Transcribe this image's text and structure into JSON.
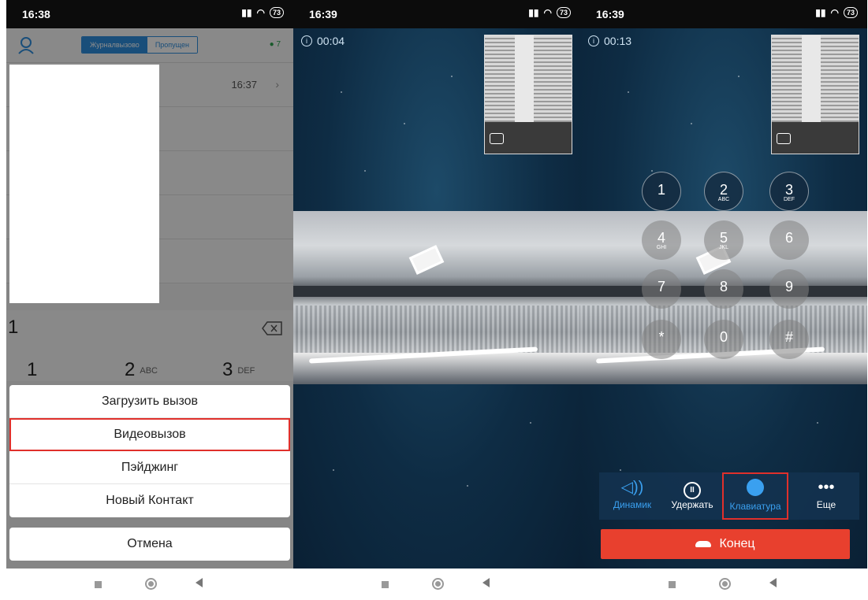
{
  "panel1": {
    "status": {
      "time": "16:38",
      "battery": "73"
    },
    "tabs": [
      {
        "label": "Журналвызово"
      },
      {
        "label": "Пропущен"
      }
    ],
    "count": "7",
    "row": {
      "time": "16:37"
    },
    "dial_value": "1",
    "keys": [
      {
        "n": "1",
        "l": ""
      },
      {
        "n": "2",
        "l": "ABC"
      },
      {
        "n": "3",
        "l": "DEF"
      }
    ],
    "sheet": [
      "Загрузить вызов",
      "Видеовызов",
      "Пэйджинг",
      "Новый Контакт"
    ],
    "cancel": "Отмена"
  },
  "panel2": {
    "status": {
      "time": "16:39",
      "battery": "73"
    },
    "timer": "00:04"
  },
  "panel3": {
    "status": {
      "time": "16:39",
      "battery": "73"
    },
    "timer": "00:13",
    "keypad": [
      {
        "n": "1",
        "l": ""
      },
      {
        "n": "2",
        "l": "ABC"
      },
      {
        "n": "3",
        "l": "DEF"
      },
      {
        "n": "4",
        "l": "GHI"
      },
      {
        "n": "5",
        "l": "JKL"
      },
      {
        "n": "6",
        "l": ""
      },
      {
        "n": "7",
        "l": ""
      },
      {
        "n": "8",
        "l": ""
      },
      {
        "n": "9",
        "l": ""
      },
      {
        "n": "*",
        "l": ""
      },
      {
        "n": "0",
        "l": ""
      },
      {
        "n": "#",
        "l": ""
      }
    ],
    "controls": [
      "Динамик",
      "Удержать",
      "Клавиатура",
      "Еще"
    ],
    "end_label": "Конец"
  },
  "colors": {
    "accent": "#2f8fdf",
    "end": "#e8402e",
    "highlight": "#e0302b"
  }
}
